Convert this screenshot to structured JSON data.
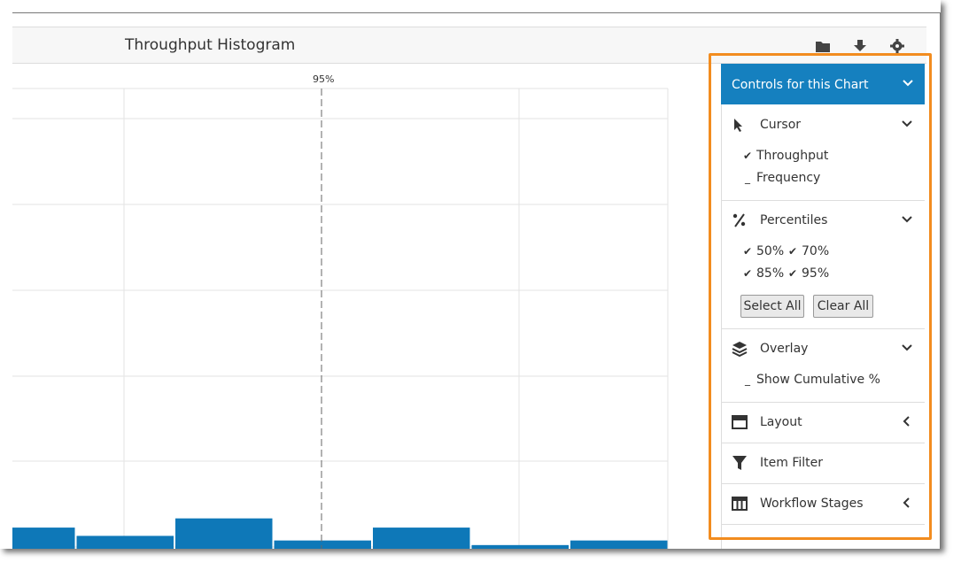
{
  "chart": {
    "title": "Throughput Histogram",
    "percentile_marker": "95%"
  },
  "header_icons": [
    "folder-icon",
    "download-icon",
    "gear-icon"
  ],
  "panel": {
    "title": "Controls for this Chart",
    "cursor": {
      "label": "Cursor",
      "options": [
        {
          "label": "Throughput",
          "checked": true
        },
        {
          "label": "Frequency",
          "checked": false
        }
      ]
    },
    "percentiles": {
      "label": "Percentiles",
      "options": [
        {
          "label": "50%",
          "checked": true
        },
        {
          "label": "70%",
          "checked": true
        },
        {
          "label": "85%",
          "checked": true
        },
        {
          "label": "95%",
          "checked": true
        }
      ],
      "select_all": "Select All",
      "clear_all": "Clear All"
    },
    "overlay": {
      "label": "Overlay",
      "options": [
        {
          "label": "Show Cumulative %",
          "checked": false
        }
      ]
    },
    "layout": {
      "label": "Layout"
    },
    "item_filter": {
      "label": "Item Filter"
    },
    "workflow_stages": {
      "label": "Workflow Stages"
    }
  },
  "chart_data": {
    "type": "bar",
    "title": "Throughput Histogram",
    "bars": [
      2.3,
      1.4,
      3.3,
      0.9,
      2.3,
      0.4,
      0.9
    ],
    "ylim": [
      0,
      50
    ],
    "percentile_lines": [
      "95%"
    ]
  }
}
